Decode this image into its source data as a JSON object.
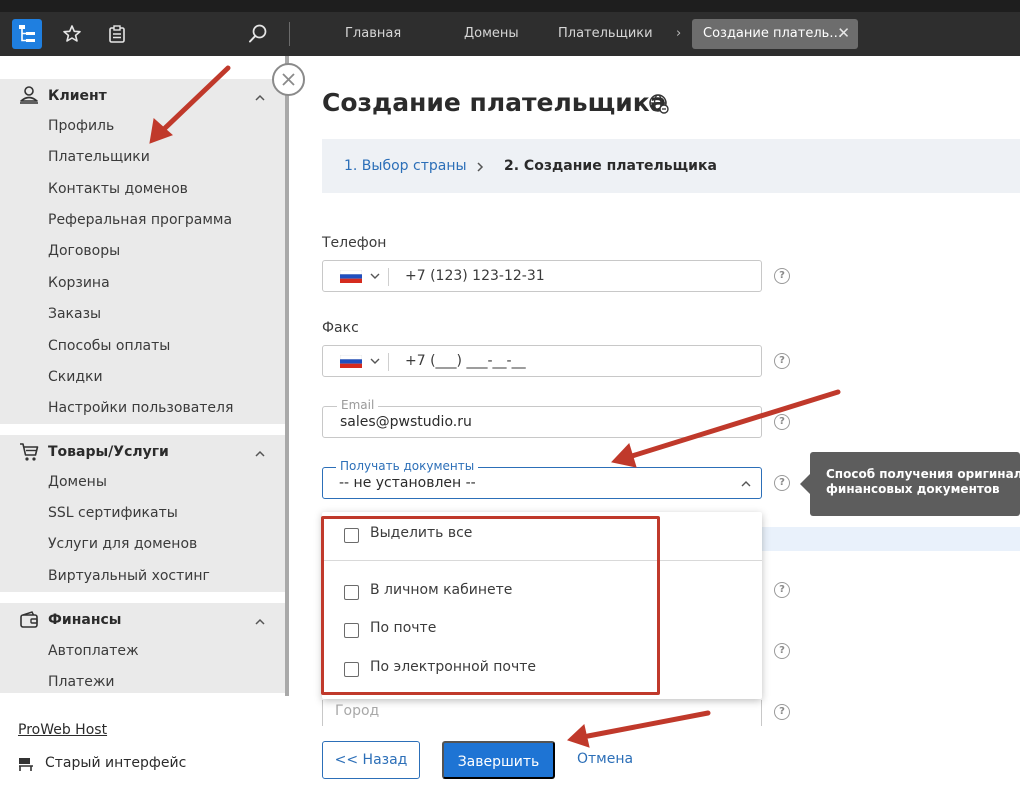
{
  "topbar": {
    "links": [
      "Главная",
      "Домены",
      "Плательщики"
    ],
    "active_tab": "Создание платель…",
    "close_glyph": "✕",
    "chevron_glyph": "›"
  },
  "sidebar": {
    "client": {
      "title": "Клиент",
      "items": [
        "Профиль",
        "Плательщики",
        "Контакты доменов",
        "Реферальная программа",
        "Договоры",
        "Корзина",
        "Заказы",
        "Способы оплаты",
        "Скидки",
        "Настройки пользователя"
      ]
    },
    "goods": {
      "title": "Товары/Услуги",
      "items": [
        "Домены",
        "SSL сертификаты",
        "Услуги для доменов",
        "Виртуальный хостинг"
      ]
    },
    "finance": {
      "title": "Финансы",
      "items": [
        "Автоплатеж",
        "Платежи"
      ]
    },
    "footer_link": "ProWeb Host",
    "old_interface": "Старый интерфейс"
  },
  "main": {
    "title": "Создание плательщика",
    "steps": [
      "1. Выбор страны",
      "2. Создание плательщика"
    ],
    "phone": {
      "label": "Телефон",
      "value": "+7 (123) 123-12-31"
    },
    "fax": {
      "label": "Факс",
      "value": "+7 (___) ___-__-__"
    },
    "email": {
      "label": "Email",
      "value": "sales@pwstudio.ru"
    },
    "docs": {
      "label": "Получать документы",
      "value": "-- не установлен --"
    },
    "tooltip": [
      "Способ получения оригиналов",
      "финансовых документов"
    ],
    "dropdown": {
      "select_all": "Выделить все",
      "options": [
        "В личном кабинете",
        "По почте",
        "По электронной почте"
      ]
    },
    "city_placeholder": "Город",
    "help_glyph": "?",
    "buttons": {
      "back": "<< Назад",
      "finish": "Завершить",
      "cancel": "Отмена"
    }
  },
  "colors": {
    "accent": "#1e74d4",
    "link": "#2c6fb8",
    "annotation": "#c0392b",
    "topbar": "#2e2e2e",
    "sidebar_bg": "#eaeaea"
  }
}
